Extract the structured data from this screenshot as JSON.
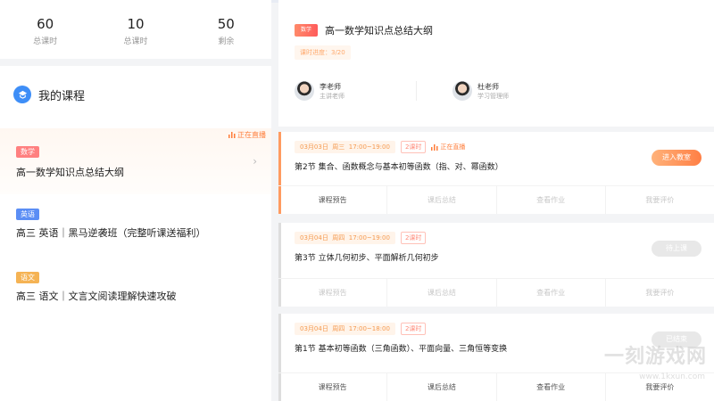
{
  "stats": [
    {
      "value": "60",
      "label": "总课时"
    },
    {
      "value": "10",
      "label": "总课时"
    },
    {
      "value": "50",
      "label": "剩余"
    }
  ],
  "my_courses": {
    "title": "我的课程",
    "live_label": "正在直播",
    "items": [
      {
        "subject": "数学",
        "subject_color": "#ff7373",
        "title": "高一数学知识点总结大纲"
      },
      {
        "subject": "英语",
        "subject_color": "#5b8ef5",
        "title": "高三 英语｜黑马逆袭班（完整听课送福利）"
      },
      {
        "subject": "语文",
        "subject_color": "#f5b354",
        "title": "高三 语文｜文言文阅读理解快速攻破"
      }
    ]
  },
  "detail": {
    "badge": "数学",
    "title": "高一数学知识点总结大纲",
    "progress": "课时进度：3/20",
    "teachers": [
      {
        "name": "李老师",
        "role": "主讲老师"
      },
      {
        "name": "杜老师",
        "role": "学习管理师"
      }
    ]
  },
  "lessons": [
    {
      "date": "03月03日",
      "weekday": "周三",
      "time": "17:00~19:00",
      "length": "2课时",
      "live": "正在直播",
      "title": "第2节 集合、函数概念与基本初等函数（指、对、幂函数）",
      "button": "进入教室",
      "ops": [
        "课程预告",
        "课后总结",
        "查看作业",
        "我要评价"
      ]
    },
    {
      "date": "03月04日",
      "weekday": "周四",
      "time": "17:00~19:00",
      "length": "2课时",
      "title": "第3节 立体几何初步、平面解析几何初步",
      "button": "待上课",
      "ops": [
        "课程预告",
        "课后总结",
        "查看作业",
        "我要评价"
      ]
    },
    {
      "date": "03月04日",
      "weekday": "周四",
      "time": "17:00~18:00",
      "length": "2课时",
      "title": "第1节 基本初等函数（三角函数）、平面向量、三角恒等变换",
      "button": "已结束",
      "ops": [
        "课程预告",
        "课后总结",
        "查看作业",
        "我要评价"
      ]
    }
  ],
  "watermark": {
    "text": "一刻游戏网",
    "url": "www.1kxun.com"
  }
}
